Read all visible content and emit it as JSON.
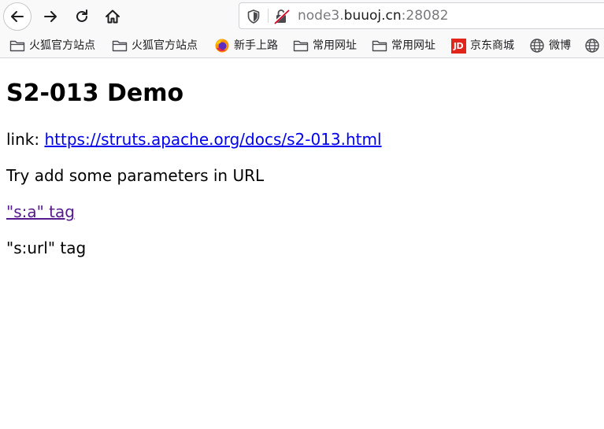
{
  "browser": {
    "url": {
      "prefix": "node3.",
      "domain": "buuoj.cn",
      "suffix": ":28082"
    },
    "bookmarks": [
      {
        "label": "火狐官方站点",
        "icon": "folder-icon"
      },
      {
        "label": "火狐官方站点",
        "icon": "folder-icon"
      },
      {
        "label": "新手上路",
        "icon": "firefox-icon"
      },
      {
        "label": "常用网址",
        "icon": "folder-icon"
      },
      {
        "label": "常用网址",
        "icon": "folder-icon"
      },
      {
        "label": "京东商城",
        "icon": "jd-icon",
        "icon_text": "JD"
      },
      {
        "label": "微博",
        "icon": "globe-icon"
      },
      {
        "label": "",
        "icon": "globe-icon"
      }
    ],
    "colors": {
      "jd_red": "#e1251b",
      "link": "#0000ee",
      "visited_link": "#551a8b"
    }
  },
  "page": {
    "title": "S2-013 Demo",
    "link_prefix": "link: ",
    "link_text": "https://struts.apache.org/docs/s2-013.html",
    "instruction": "Try add some parameters in URL",
    "sa_tag_link": "\"s:a\" tag",
    "surl_tag": "\"s:url\" tag"
  }
}
